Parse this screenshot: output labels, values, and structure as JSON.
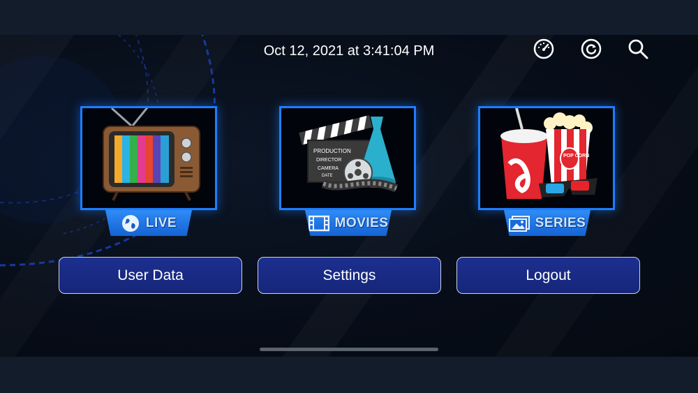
{
  "header": {
    "datetime": "Oct 12, 2021 at 3:41:04 PM",
    "icons": [
      "speedometer-icon",
      "refresh-icon",
      "search-icon"
    ]
  },
  "categories": [
    {
      "label": "LIVE",
      "image": "retro-tv",
      "icon": "globe-icon"
    },
    {
      "label": "MOVIES",
      "image": "clapperboard-film",
      "icon": "film-strip-icon"
    },
    {
      "label": "SERIES",
      "image": "popcorn-soda-3d-glasses",
      "icon": "picture-icon"
    }
  ],
  "buttons": {
    "user_data": "User Data",
    "settings": "Settings",
    "logout": "Logout"
  },
  "clapper": {
    "line1": "PRODUCTION",
    "line2": "DIRECTOR",
    "line3": "CAMERA",
    "line4": "DATE"
  },
  "popcorn_text": "POP CORN",
  "colors": {
    "accent": "#1e7dff",
    "button_bg": "#1c2f8f",
    "background": "#070d18"
  }
}
